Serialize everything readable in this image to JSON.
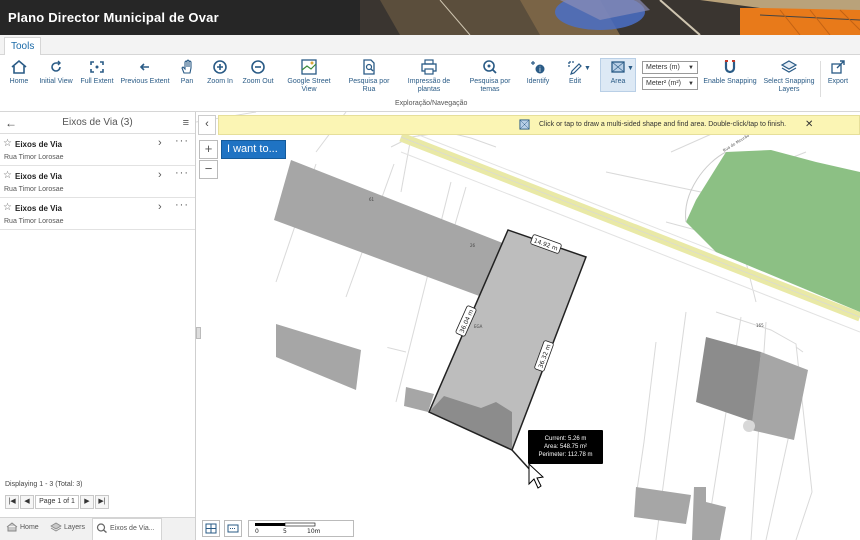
{
  "header": {
    "title": "Plano Director Municipal de Ovar"
  },
  "toolbar": {
    "tab": "Tools",
    "group_label": "Exploração/Navegação",
    "tools": {
      "home": "Home",
      "initial_view": "Initial View",
      "full_extent": "Full Extent",
      "previous_extent": "Previous Extent",
      "pan": "Pan",
      "zoom_in": "Zoom In",
      "zoom_out": "Zoom Out",
      "google_street_view": "Google Street View",
      "pesquisa_por_rua": "Pesquisa por Rua",
      "impressao_de_plantas": "Impressão de plantas",
      "pesquisa_por_temas": "Pesquisa por temas",
      "identify": "Identify",
      "edit": "Edit",
      "area": "Area",
      "enable_snapping": "Enable Snapping",
      "select_snapping_layers": "Select Snapping Layers",
      "export": "Export"
    },
    "units_length": "Meters (m)",
    "units_area": "Meter² (m²)"
  },
  "panel": {
    "title": "Eixos de Via (3)",
    "results": [
      {
        "title": "Eixos de Via",
        "subtitle": "Rua Timor Lorosae"
      },
      {
        "title": "Eixos de Via",
        "subtitle": "Rua Timor Lorosae"
      },
      {
        "title": "Eixos de Via",
        "subtitle": "Rua Timor Lorosae"
      }
    ],
    "status": "Displaying 1 - 3 (Total: 3)",
    "page": "Page 1 of 1",
    "bottom_tabs": {
      "home": "Home",
      "layers": "Layers",
      "eixos": "Eixos de Via..."
    }
  },
  "map": {
    "hint": "Click or tap to draw a multi-sided shape and find area. Double-click/tap to finish.",
    "i_want_to": "I want to...",
    "zoom_in": "+",
    "zoom_out": "−",
    "measurements": {
      "top": "14.92 m",
      "left": "36.04 m",
      "right": "36.32 m"
    },
    "tooltip": {
      "current": "Current: 5.26 m",
      "area": "Area: 548.75 m²",
      "perimeter": "Perimeter: 112.78 m"
    },
    "scale": {
      "t0": "0",
      "t1": "5",
      "t2": "10m"
    },
    "parcel_labels": {
      "a": "61",
      "b": "26",
      "c": "EGA",
      "d": "165"
    },
    "street_label": "Rua do Mourão"
  },
  "colors": {
    "accent": "#1f73c3",
    "hint_bg": "#fbf5b4",
    "parcel_dark": "#8c8c8c",
    "parcel_mid": "#a6a6a6",
    "green": "#8cc084",
    "road": "#e9e9a6"
  }
}
